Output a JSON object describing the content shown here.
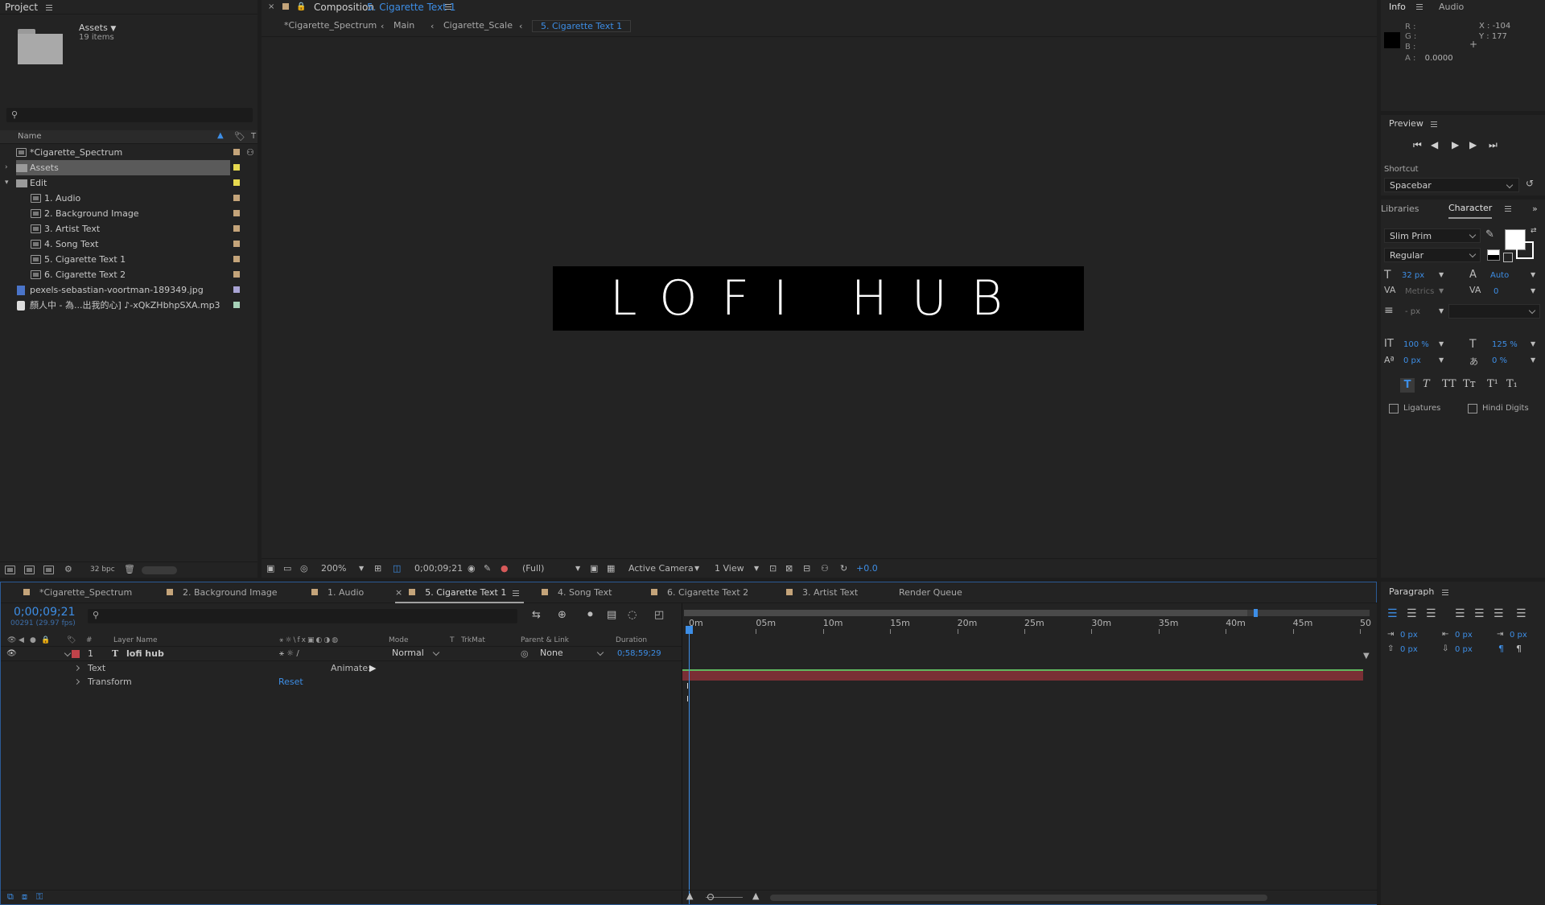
{
  "project": {
    "title": "Project",
    "folder_name": "Assets",
    "folder_count": "19 items",
    "col_name": "Name",
    "items": [
      {
        "label": "*Cigarette_Spectrum",
        "type": "comp",
        "color": "#c4a47a",
        "indent": 0
      },
      {
        "label": "Assets",
        "type": "folder",
        "color": "#e6d94f",
        "indent": 0,
        "selected": true
      },
      {
        "label": "Edit",
        "type": "folder",
        "color": "#e6d94f",
        "indent": 0,
        "expanded": true
      },
      {
        "label": "1. Audio",
        "type": "comp",
        "color": "#c4a47a",
        "indent": 1
      },
      {
        "label": "2. Background Image",
        "type": "comp",
        "color": "#c4a47a",
        "indent": 1
      },
      {
        "label": "3. Artist Text",
        "type": "comp",
        "color": "#c4a47a",
        "indent": 1
      },
      {
        "label": "4. Song Text",
        "type": "comp",
        "color": "#c4a47a",
        "indent": 1
      },
      {
        "label": "5. Cigarette Text 1",
        "type": "comp",
        "color": "#c4a47a",
        "indent": 1
      },
      {
        "label": "6. Cigarette Text 2",
        "type": "comp",
        "color": "#c4a47a",
        "indent": 1
      },
      {
        "label": "pexels-sebastian-voortman-189349.jpg",
        "type": "image",
        "color": "#a9a4d4",
        "indent": 0
      },
      {
        "label": "顏人中 - 為...出我的心] ♪-xQkZHbhpSXA.mp3",
        "type": "audio",
        "color": "#a7d1b8",
        "indent": 0
      }
    ],
    "bpc": "32 bpc"
  },
  "composition": {
    "label": "Composition",
    "name": "5. Cigarette Text 1",
    "breadcrumbs": [
      "*Cigarette_Spectrum",
      "Main",
      "Cigarette_Scale",
      "5. Cigarette Text 1"
    ],
    "canvas_text": "LOFI HUB",
    "zoom": "200%",
    "timecode": "0;00;09;21",
    "resolution": "(Full)",
    "camera": "Active Camera",
    "views": "1 View",
    "exposure": "+0.0"
  },
  "info": {
    "tab_info": "Info",
    "tab_audio": "Audio",
    "r": "R :",
    "g": "G :",
    "b": "B :",
    "a": "A :",
    "a_value": "0.0000",
    "x": "X : -104",
    "y": "Y : 177"
  },
  "preview": {
    "title": "Preview",
    "shortcut_label": "Shortcut",
    "shortcut_value": "Spacebar"
  },
  "character": {
    "tab_libraries": "Libraries",
    "tab_character": "Character",
    "font": "Slim Prim",
    "style": "Regular",
    "size": "32 px",
    "leading": "Auto",
    "kerning": "Metrics",
    "tracking": "0",
    "stroke": "- px",
    "vscale": "100 %",
    "hscale": "125 %",
    "baseline": "0 px",
    "tsume": "0 %",
    "ligatures": "Ligatures",
    "hindi": "Hindi Digits"
  },
  "paragraph": {
    "title": "Paragraph",
    "indent_left": "0 px",
    "indent_first": "0 px",
    "indent_right": "0 px",
    "space_before": "0 px",
    "space_after": "0 px"
  },
  "timeline": {
    "tabs": [
      "*Cigarette_Spectrum",
      "2. Background Image",
      "1. Audio",
      "5. Cigarette Text 1",
      "4. Song Text",
      "6. Cigarette Text 2",
      "3. Artist Text",
      "Render Queue"
    ],
    "tab_colors": [
      "#c4a47a",
      "#c4a47a",
      "#c4a47a",
      "#c4a47a",
      "#c4a47a",
      "#c4a47a",
      "#c4a47a"
    ],
    "timecode": "0;00;09;21",
    "frames": "00291 (29.97 fps)",
    "columns": {
      "layer_name": "Layer Name",
      "mode": "Mode",
      "t": "T",
      "trkmat": "TrkMat",
      "parent": "Parent & Link",
      "duration": "Duration"
    },
    "layer": {
      "num": "1",
      "name": "lofi hub",
      "mode": "Normal",
      "parent": "None",
      "duration": "0;58;59;29",
      "color": "#c0434a"
    },
    "sub_text": "Text",
    "animate": "Animate:",
    "sub_transform": "Transform",
    "reset": "Reset",
    "ruler": [
      "0m",
      "05m",
      "10m",
      "15m",
      "20m",
      "25m",
      "30m",
      "35m",
      "40m",
      "45m",
      "50"
    ]
  }
}
